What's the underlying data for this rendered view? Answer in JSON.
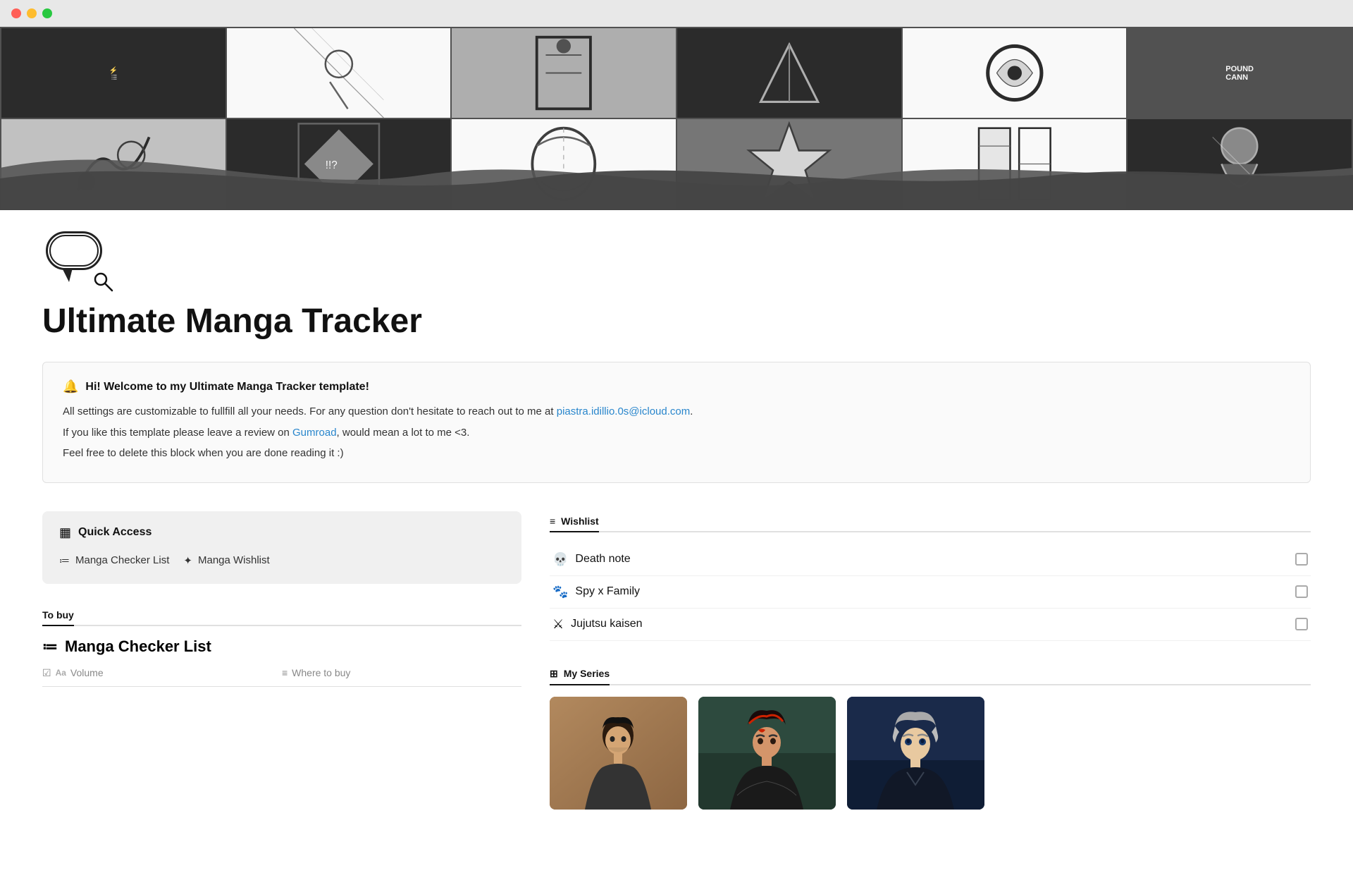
{
  "titlebar": {
    "close": "close",
    "minimize": "minimize",
    "maximize": "maximize"
  },
  "page": {
    "title": "Ultimate Manga Tracker",
    "icon": "speech-bubble"
  },
  "welcome": {
    "icon": "🔔",
    "title": "Hi! Welcome to my Ultimate Manga Tracker template!",
    "line1": "All settings are customizable to fullfill all your needs. For any question don't hesitate to reach out to me at ",
    "email": "piastra.idillio.0s@icloud.com",
    "line2_prefix": "If you like this template please leave a review on ",
    "gumroad": "Gumroad",
    "line2_suffix": ", would mean a lot to me <3.",
    "line3": "Feel free to delete this block when you are done reading it :)"
  },
  "quickAccess": {
    "icon": "▦",
    "title": "Quick Access",
    "links": [
      {
        "icon": "≔",
        "label": "Manga Checker List"
      },
      {
        "icon": "✦",
        "label": "Manga Wishlist"
      }
    ]
  },
  "mangaCheckerTab": {
    "tabs": [
      {
        "label": "To buy",
        "active": true
      }
    ],
    "title": "Manga Checker List",
    "icon": "≔",
    "columns": [
      {
        "icon": "☑",
        "prefix": "Aa",
        "label": "Volume"
      },
      {
        "icon": "≡",
        "label": "Where to buy"
      }
    ]
  },
  "wishlist": {
    "tabIcon": "≡",
    "tabLabel": "Wishlist",
    "items": [
      {
        "icon": "💀",
        "title": "Death note"
      },
      {
        "icon": "🐾",
        "title": "Spy x Family"
      },
      {
        "icon": "⚔",
        "title": "Jujutsu kaisen"
      }
    ]
  },
  "mySeries": {
    "tabIcon": "⊞",
    "tabLabel": "My Series",
    "cards": [
      {
        "id": "card-1",
        "bgClass": "card-bg-1",
        "alt": "Manga series character 1"
      },
      {
        "id": "card-2",
        "bgClass": "card-bg-2",
        "alt": "Manga series character 2"
      },
      {
        "id": "card-3",
        "bgClass": "card-bg-3",
        "alt": "Manga series character 3"
      }
    ]
  }
}
